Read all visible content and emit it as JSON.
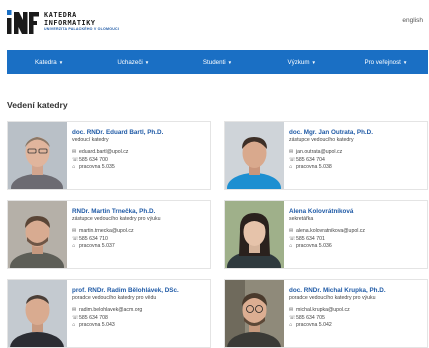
{
  "header": {
    "logo_lines": [
      "KATEDRA",
      "INFORMATIKY"
    ],
    "logo_subtitle": "UNIVERZITA PALACKÉHO V OLOMOUCI",
    "lang_link": "english"
  },
  "nav": [
    {
      "label": "Katedra"
    },
    {
      "label": "Uchazeči"
    },
    {
      "label": "Studenti"
    },
    {
      "label": "Výzkum"
    },
    {
      "label": "Pro veřejnost"
    }
  ],
  "section_title": "Vedení katedry",
  "people": [
    {
      "name": "doc. RNDr. Eduard Bartl, Ph.D.",
      "role": "vedoucí katedry",
      "email": "eduard.bartl@upol.cz",
      "phone": "585 634 700",
      "room": "pracovna 5.035"
    },
    {
      "name": "doc. Mgr. Jan Outrata, Ph.D.",
      "role": "zástupce vedoucího katedry",
      "email": "jan.outrata@upol.cz",
      "phone": "585 634 704",
      "room": "pracovna 5.038"
    },
    {
      "name": "RNDr. Martin Trnečka, Ph.D.",
      "role": "zástupce vedoucího katedry pro výuku",
      "email": "martin.trnecka@upol.cz",
      "phone": "585 634 710",
      "room": "pracovna 5.037"
    },
    {
      "name": "Alena Kolovrátníková",
      "role": "sekretářka",
      "email": "alena.kolovratnikova@upol.cz",
      "phone": "585 634 701",
      "room": "pracovna 5.036"
    },
    {
      "name": "prof. RNDr. Radim Bělohlávek, DSc.",
      "role": "poradce vedoucího katedry pro vědu",
      "email": "radim.belohlavek@acm.org",
      "phone": "585 634 708",
      "room": "pracovna 5.043"
    },
    {
      "name": "doc. RNDr. Michal Krupka, Ph.D.",
      "role": "poradce vedoucího katedry pro výuku",
      "email": "michal.krupka@upol.cz",
      "phone": "585 634 705",
      "room": "pracovna 5.042"
    }
  ],
  "icons": {
    "email": "envelope-icon",
    "phone": "phone-icon",
    "room": "house-icon"
  },
  "colors": {
    "nav": "#1a6fc4",
    "name": "#1f5aa6"
  }
}
